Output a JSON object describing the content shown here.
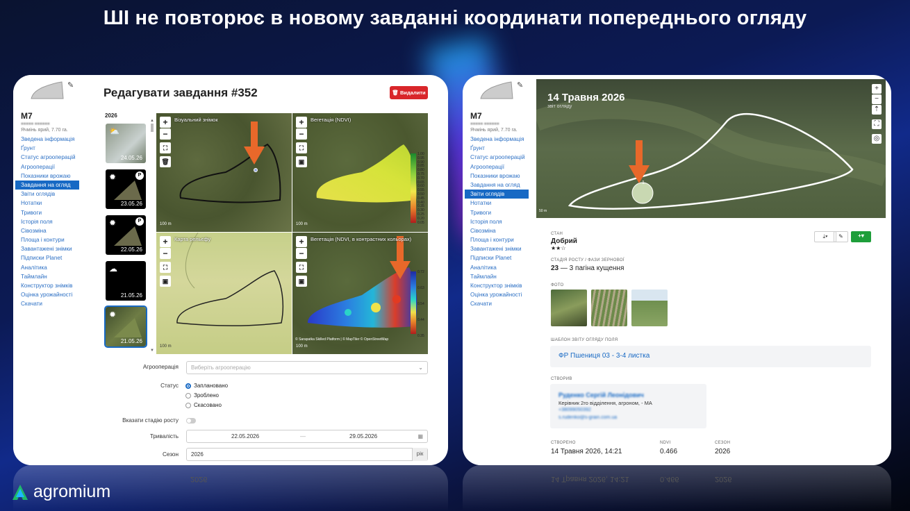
{
  "headline": "ШІ не повторює в новому завданні координати попереднього огляду",
  "logo": {
    "name": "agromium"
  },
  "sidebar": {
    "field_name": "М7",
    "field_sub": "Ячмінь ярий, 7.70 га.",
    "items": [
      "Зведена інформація",
      "Ґрунт",
      "Статус агрооперацій",
      "Агрооперації",
      "Показники врожаю",
      "Завдання на огляд",
      "Звіти оглядів",
      "Нотатки",
      "Тривоги",
      "Історія поля",
      "Сівозміна",
      "Площа і контури",
      "Завантажені знімки",
      "Підписки Planet",
      "Аналітика",
      "Таймлайн",
      "Конструктор знімків",
      "Оцінка урожайності",
      "Скачати"
    ]
  },
  "left": {
    "title": "Редагувати завдання #352",
    "delete_label": "Видалити",
    "year": "2026",
    "thumbs": [
      {
        "date": "24.05.26",
        "icon": "⛅",
        "badge": ""
      },
      {
        "date": "23.05.26",
        "icon": "✹",
        "badge": "P"
      },
      {
        "date": "22.05.26",
        "icon": "✹",
        "badge": "P"
      },
      {
        "date": "21.05.26",
        "icon": "☁",
        "badge": ""
      },
      {
        "date": "21.05.26",
        "icon": "✹",
        "badge": ""
      }
    ],
    "maps": {
      "m1": "Візуальний знімок",
      "m2": "Вегетація (NDVI)",
      "m3": "Карта рельєфу",
      "m4": "Вегетація (NDVI, в контрастних кольорах)",
      "scale": "100 m",
      "attrib": "© Sarapatka Skilled Platform | © MapTiler © OpenStreetMap",
      "legend2": [
        "1.00",
        "0.95",
        "0.90",
        "0.85",
        "0.80",
        "0.75",
        "0.70",
        "0.65",
        "0.60",
        "0.55",
        "0.50",
        "0.45",
        "0.40",
        "0.35",
        "0.30",
        "0.25",
        "0.20",
        "0.05"
      ],
      "legend4": [
        "0.72",
        "0.63",
        "0.54",
        "0.44",
        "0.35"
      ]
    },
    "form": {
      "agro_label": "Агрооперація",
      "agro_placeholder": "Виберіть агрооперацію",
      "status_label": "Статус",
      "status_options": [
        "Заплановано",
        "Зроблено",
        "Скасовано"
      ],
      "stage_label": "Вказати стадію росту",
      "duration_label": "Тривалість",
      "date_from": "22.05.2026",
      "date_sep": "—",
      "date_to": "29.05.2026",
      "season_label": "Сезон",
      "season_value": "2026",
      "season_suffix": "рік"
    }
  },
  "right": {
    "report_title": "14 Травня 2026",
    "report_sub": "звіт огляду",
    "marker": "1",
    "state_label": "СТАН",
    "state_value": "Добрий",
    "stars": "★★☆",
    "stage_label": "СТАДІЯ РОСТУ / ФАЗИ ЗЕРНОВОЇ",
    "stage_num": "23",
    "stage_text": "— 3 пагіна кущення",
    "photo_label": "ФОТО",
    "template_label": "ШАБЛОН ЗВІТУ ОГЛЯДУ ПОЛЯ",
    "template_value": "ФР Пшениця 03 - 3-4 листка",
    "created_label": "СТВОРИВ",
    "author_name": "Руденко Сергій Леонідович",
    "author_role": "Керівник 2го відділення, агроном, - МА",
    "author_phone": "+38099050392",
    "author_email": "s.rudenko@s-grain.com.ua",
    "created_date_label": "СТВОРЕНО",
    "created_date": "14 Травня 2026, 14:21",
    "ndvi_label": "NDVI",
    "ndvi_value": "0.466",
    "season_label": "СЕЗОН",
    "season_value": "2026",
    "scale": "50 m"
  },
  "colors": {
    "accent": "#1769c4",
    "danger": "#d9262a",
    "success": "#1e9e3a",
    "arrow": "#e8682a"
  }
}
